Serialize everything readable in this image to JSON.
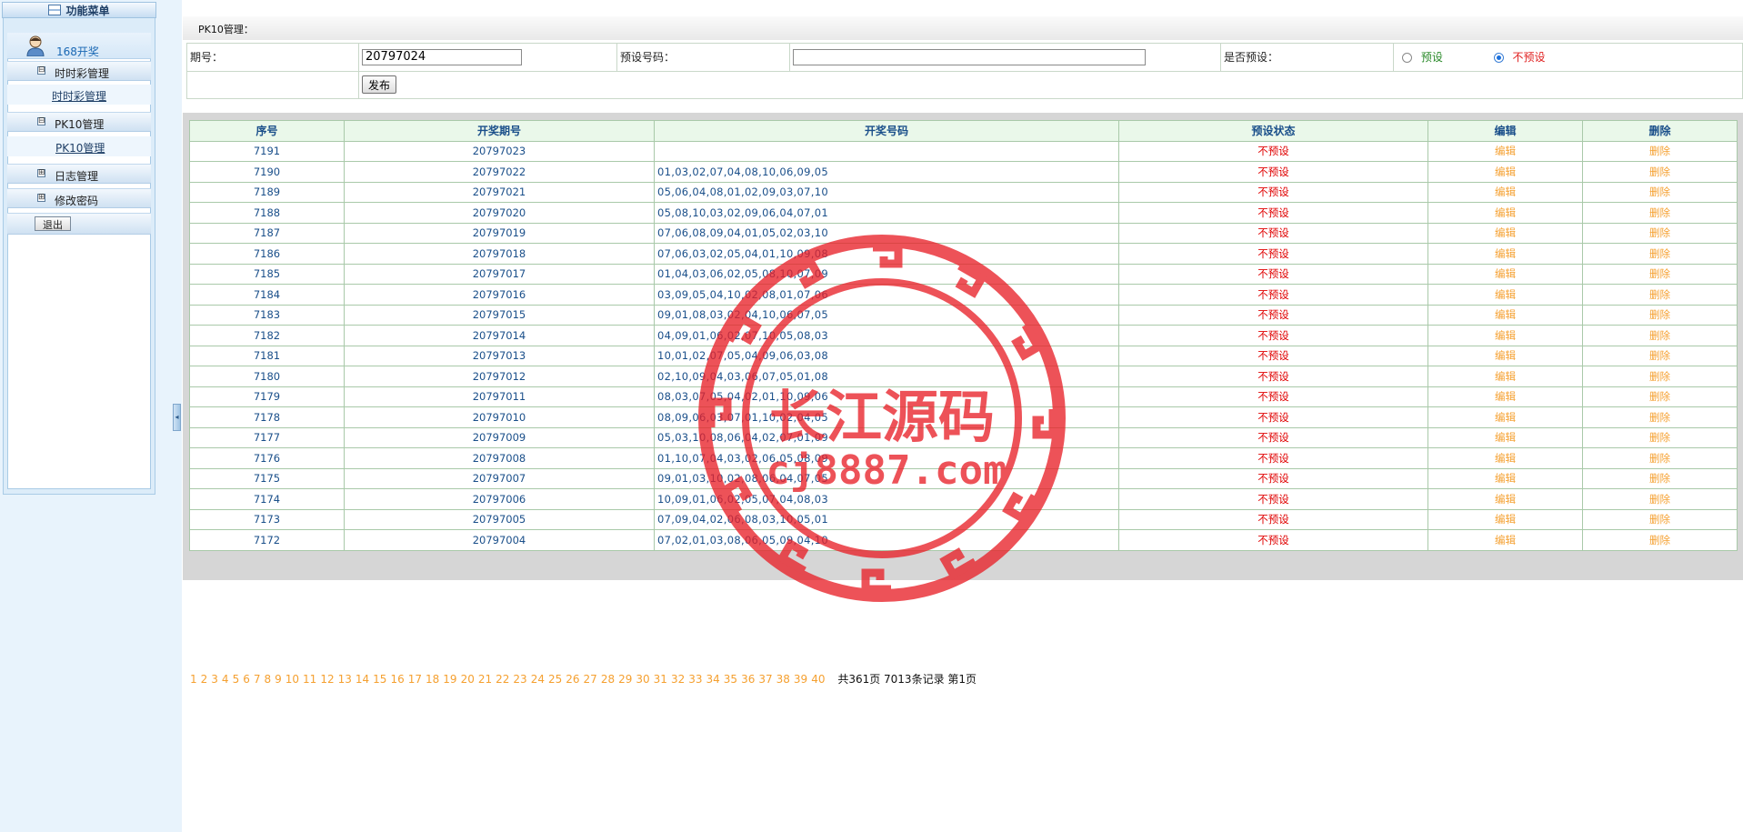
{
  "sidebar": {
    "title": "功能菜单",
    "user_name": "168开奖",
    "groups": [
      {
        "label": "时时彩管理",
        "toggle": "⊟",
        "sub": "时时彩管理"
      },
      {
        "label": "PK10管理",
        "toggle": "⊟",
        "sub": "PK10管理"
      },
      {
        "label": "日志管理",
        "toggle": "⊞"
      },
      {
        "label": "修改密码",
        "toggle": "⊞"
      }
    ],
    "logout_label": "退出"
  },
  "header": {
    "title": "PK10管理："
  },
  "form": {
    "issue_label": "期号：",
    "issue_value": "20797024",
    "preset_code_label": "预设号码：",
    "preset_code_value": "",
    "is_preset_label": "是否预设：",
    "radio_preset": "预设",
    "radio_not_preset": "不预设",
    "selected": "不预设",
    "publish_label": "发布"
  },
  "table": {
    "headers": [
      "序号",
      "开奖期号",
      "开奖号码",
      "预设状态",
      "编辑",
      "删除"
    ],
    "rows": [
      {
        "id": "7191",
        "issue": "20797023",
        "nums": "",
        "status": "不预设",
        "edit": "编辑",
        "del": "删除"
      },
      {
        "id": "7190",
        "issue": "20797022",
        "nums": "01,03,02,07,04,08,10,06,09,05",
        "status": "不预设",
        "edit": "编辑",
        "del": "删除"
      },
      {
        "id": "7189",
        "issue": "20797021",
        "nums": "05,06,04,08,01,02,09,03,07,10",
        "status": "不预设",
        "edit": "编辑",
        "del": "删除"
      },
      {
        "id": "7188",
        "issue": "20797020",
        "nums": "05,08,10,03,02,09,06,04,07,01",
        "status": "不预设",
        "edit": "编辑",
        "del": "删除"
      },
      {
        "id": "7187",
        "issue": "20797019",
        "nums": "07,06,08,09,04,01,05,02,03,10",
        "status": "不预设",
        "edit": "编辑",
        "del": "删除"
      },
      {
        "id": "7186",
        "issue": "20797018",
        "nums": "07,06,03,02,05,04,01,10,09,08",
        "status": "不预设",
        "edit": "编辑",
        "del": "删除"
      },
      {
        "id": "7185",
        "issue": "20797017",
        "nums": "01,04,03,06,02,05,08,10,07,09",
        "status": "不预设",
        "edit": "编辑",
        "del": "删除"
      },
      {
        "id": "7184",
        "issue": "20797016",
        "nums": "03,09,05,04,10,02,08,01,07,06",
        "status": "不预设",
        "edit": "编辑",
        "del": "删除"
      },
      {
        "id": "7183",
        "issue": "20797015",
        "nums": "09,01,08,03,02,04,10,06,07,05",
        "status": "不预设",
        "edit": "编辑",
        "del": "删除"
      },
      {
        "id": "7182",
        "issue": "20797014",
        "nums": "04,09,01,06,02,07,10,05,08,03",
        "status": "不预设",
        "edit": "编辑",
        "del": "删除"
      },
      {
        "id": "7181",
        "issue": "20797013",
        "nums": "10,01,02,07,05,04,09,06,03,08",
        "status": "不预设",
        "edit": "编辑",
        "del": "删除"
      },
      {
        "id": "7180",
        "issue": "20797012",
        "nums": "02,10,09,04,03,06,07,05,01,08",
        "status": "不预设",
        "edit": "编辑",
        "del": "删除"
      },
      {
        "id": "7179",
        "issue": "20797011",
        "nums": "08,03,07,05,04,02,01,10,09,06",
        "status": "不预设",
        "edit": "编辑",
        "del": "删除"
      },
      {
        "id": "7178",
        "issue": "20797010",
        "nums": "08,09,06,03,07,01,10,02,04,05",
        "status": "不预设",
        "edit": "编辑",
        "del": "删除"
      },
      {
        "id": "7177",
        "issue": "20797009",
        "nums": "05,03,10,08,06,04,02,07,01,09",
        "status": "不预设",
        "edit": "编辑",
        "del": "删除"
      },
      {
        "id": "7176",
        "issue": "20797008",
        "nums": "01,10,07,04,03,02,06,05,08,09",
        "status": "不预设",
        "edit": "编辑",
        "del": "删除"
      },
      {
        "id": "7175",
        "issue": "20797007",
        "nums": "09,01,03,10,02,08,06,04,07,05",
        "status": "不预设",
        "edit": "编辑",
        "del": "删除"
      },
      {
        "id": "7174",
        "issue": "20797006",
        "nums": "10,09,01,06,02,05,07,04,08,03",
        "status": "不预设",
        "edit": "编辑",
        "del": "删除"
      },
      {
        "id": "7173",
        "issue": "20797005",
        "nums": "07,09,04,02,06,08,03,10,05,01",
        "status": "不预设",
        "edit": "编辑",
        "del": "删除"
      },
      {
        "id": "7172",
        "issue": "20797004",
        "nums": "07,02,01,03,08,06,05,09,04,10",
        "status": "不预设",
        "edit": "编辑",
        "del": "删除"
      }
    ]
  },
  "pager": {
    "pages": [
      "1",
      "2",
      "3",
      "4",
      "5",
      "6",
      "7",
      "8",
      "9",
      "10",
      "11",
      "12",
      "13",
      "14",
      "15",
      "16",
      "17",
      "18",
      "19",
      "20",
      "21",
      "22",
      "23",
      "24",
      "25",
      "26",
      "27",
      "28",
      "29",
      "30",
      "31",
      "32",
      "33",
      "34",
      "35",
      "36",
      "37",
      "38",
      "39",
      "40"
    ],
    "summary": "共361页 7013条记录 第1页"
  },
  "watermark": {
    "line1": "长江源码",
    "line2": "cj8887.com",
    "color": "#e8222a"
  }
}
